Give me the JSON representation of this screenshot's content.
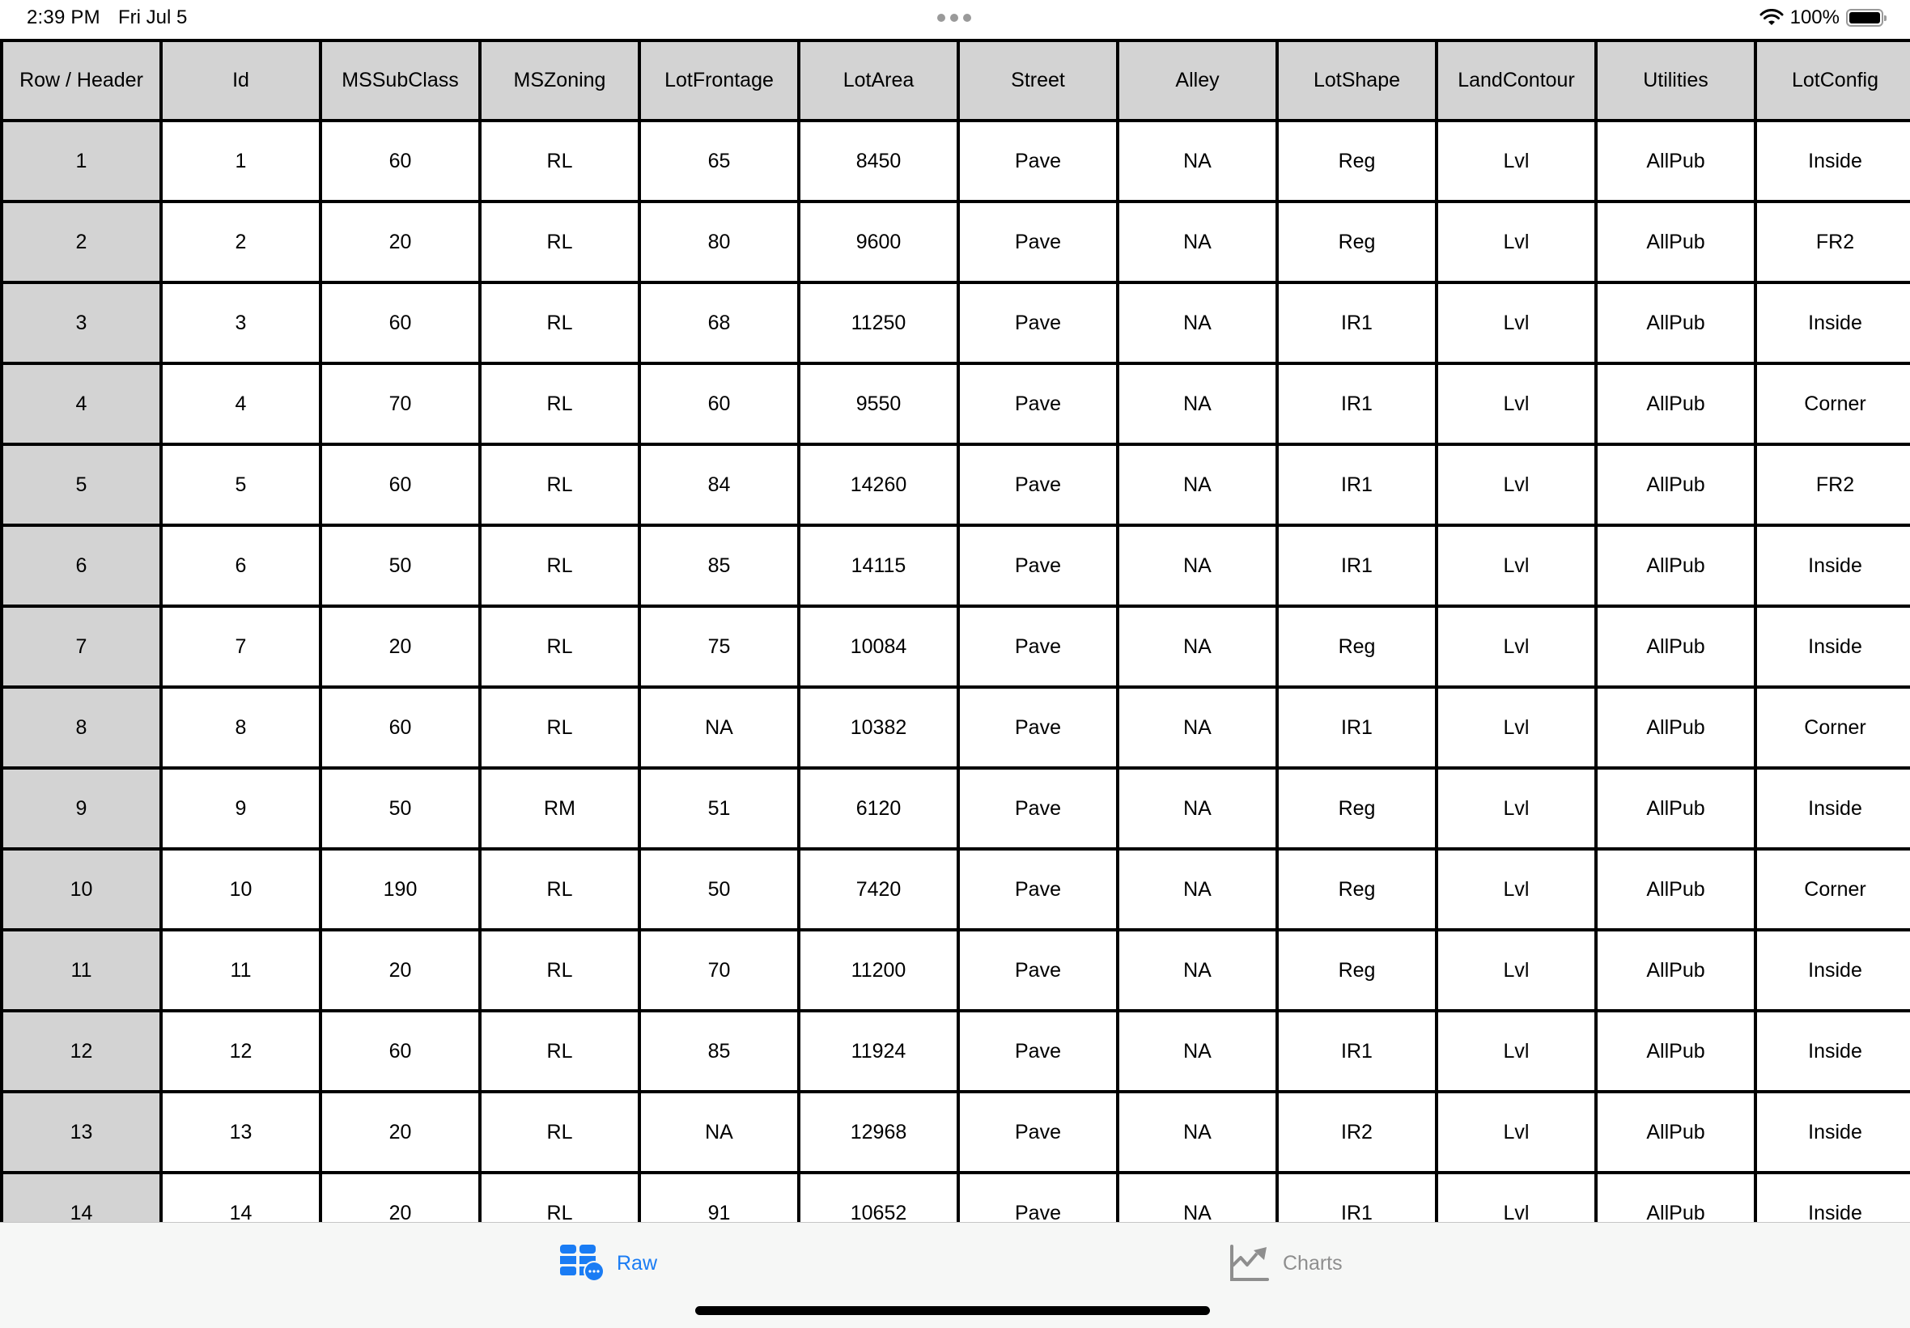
{
  "status_bar": {
    "time": "2:39 PM",
    "date": "Fri Jul 5",
    "battery_percent": "100%",
    "battery_level": 1.0,
    "icons": [
      "wifi-icon",
      "battery-icon",
      "multitasking-dots-icon"
    ]
  },
  "table": {
    "columns": [
      "Row / Header",
      "Id",
      "MSSubClass",
      "MSZoning",
      "LotFrontage",
      "LotArea",
      "Street",
      "Alley",
      "LotShape",
      "LandContour",
      "Utilities",
      "LotConfig"
    ],
    "rows": [
      [
        "1",
        "1",
        "60",
        "RL",
        "65",
        "8450",
        "Pave",
        "NA",
        "Reg",
        "Lvl",
        "AllPub",
        "Inside"
      ],
      [
        "2",
        "2",
        "20",
        "RL",
        "80",
        "9600",
        "Pave",
        "NA",
        "Reg",
        "Lvl",
        "AllPub",
        "FR2"
      ],
      [
        "3",
        "3",
        "60",
        "RL",
        "68",
        "11250",
        "Pave",
        "NA",
        "IR1",
        "Lvl",
        "AllPub",
        "Inside"
      ],
      [
        "4",
        "4",
        "70",
        "RL",
        "60",
        "9550",
        "Pave",
        "NA",
        "IR1",
        "Lvl",
        "AllPub",
        "Corner"
      ],
      [
        "5",
        "5",
        "60",
        "RL",
        "84",
        "14260",
        "Pave",
        "NA",
        "IR1",
        "Lvl",
        "AllPub",
        "FR2"
      ],
      [
        "6",
        "6",
        "50",
        "RL",
        "85",
        "14115",
        "Pave",
        "NA",
        "IR1",
        "Lvl",
        "AllPub",
        "Inside"
      ],
      [
        "7",
        "7",
        "20",
        "RL",
        "75",
        "10084",
        "Pave",
        "NA",
        "Reg",
        "Lvl",
        "AllPub",
        "Inside"
      ],
      [
        "8",
        "8",
        "60",
        "RL",
        "NA",
        "10382",
        "Pave",
        "NA",
        "IR1",
        "Lvl",
        "AllPub",
        "Corner"
      ],
      [
        "9",
        "9",
        "50",
        "RM",
        "51",
        "6120",
        "Pave",
        "NA",
        "Reg",
        "Lvl",
        "AllPub",
        "Inside"
      ],
      [
        "10",
        "10",
        "190",
        "RL",
        "50",
        "7420",
        "Pave",
        "NA",
        "Reg",
        "Lvl",
        "AllPub",
        "Corner"
      ],
      [
        "11",
        "11",
        "20",
        "RL",
        "70",
        "11200",
        "Pave",
        "NA",
        "Reg",
        "Lvl",
        "AllPub",
        "Inside"
      ],
      [
        "12",
        "12",
        "60",
        "RL",
        "85",
        "11924",
        "Pave",
        "NA",
        "IR1",
        "Lvl",
        "AllPub",
        "Inside"
      ],
      [
        "13",
        "13",
        "20",
        "RL",
        "NA",
        "12968",
        "Pave",
        "NA",
        "IR2",
        "Lvl",
        "AllPub",
        "Inside"
      ],
      [
        "14",
        "14",
        "20",
        "RL",
        "91",
        "10652",
        "Pave",
        "NA",
        "IR1",
        "Lvl",
        "AllPub",
        "Inside"
      ]
    ]
  },
  "tab_bar": {
    "tabs": [
      {
        "label": "Raw",
        "icon": "table-badge-icon",
        "selected": true
      },
      {
        "label": "Charts",
        "icon": "line-chart-icon",
        "selected": false
      }
    ],
    "active_color": "#1a7cf4",
    "inactive_color": "#8e8e8e"
  }
}
